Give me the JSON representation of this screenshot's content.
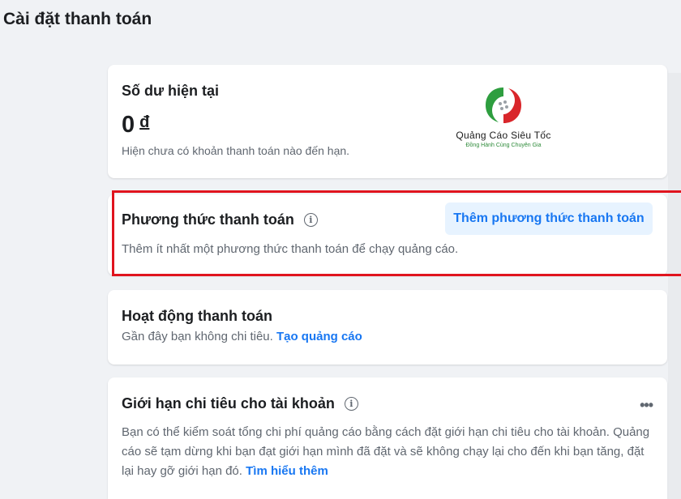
{
  "page": {
    "title": "Cài đặt thanh toán"
  },
  "balance": {
    "title": "Số dư hiện tại",
    "amount": "0",
    "currency": "đ",
    "note": "Hiện chưa có khoản thanh toán nào đến hạn."
  },
  "logo": {
    "name": "Quảng Cáo Siêu Tốc",
    "tagline": "Đồng Hành Cùng Chuyên Gia",
    "colors": {
      "green": "#2e9e3f",
      "red": "#d9262b"
    }
  },
  "payment_method": {
    "title": "Phương thức thanh toán",
    "icon": "info-icon",
    "add_button": "Thêm phương thức thanh toán",
    "note": "Thêm ít nhất một phương thức thanh toán để chạy quảng cáo.",
    "highlight_color": "#e0141e"
  },
  "activity": {
    "title": "Hoạt động thanh toán",
    "note": "Gần đây bạn không chi tiêu.",
    "link": "Tạo quảng cáo"
  },
  "spending_limit": {
    "title": "Giới hạn chi tiêu cho tài khoản",
    "icon": "info-icon",
    "menu_icon": "more-icon",
    "note": "Bạn có thể kiểm soát tổng chi phí quảng cáo bằng cách đặt giới hạn chi tiêu cho tài khoản. Quảng cáo sẽ tạm dừng khi bạn đạt giới hạn mình đã đặt và sẽ không chạy lại cho đến khi bạn tăng, đặt lại hay gỡ giới hạn đó.",
    "link": "Tìm hiểu thêm"
  },
  "colors": {
    "link": "#1877f2",
    "button_bg": "#e7f3ff",
    "background": "#f0f2f5"
  }
}
